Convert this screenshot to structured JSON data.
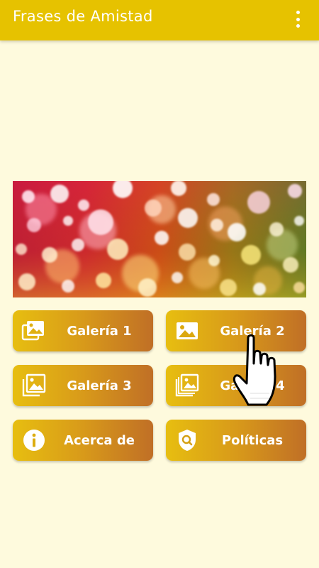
{
  "app": {
    "title": "Frases de Amistad",
    "menu_icon": "more-vert-icon"
  },
  "banner": {
    "description_icon": "bokeh-banner-image"
  },
  "buttons": [
    {
      "label": "Galería 1",
      "icon": "photo-library-icon"
    },
    {
      "label": "Galería 2",
      "icon": "image-icon"
    },
    {
      "label": "Galería 3",
      "icon": "photo-library-outline-icon"
    },
    {
      "label": "Galería 4",
      "icon": "photo-library-outline-icon"
    },
    {
      "label": "Acerca de",
      "icon": "info-icon"
    },
    {
      "label": "Políticas",
      "icon": "shield-search-icon"
    }
  ],
  "colors": {
    "appbar": "#e6c200",
    "background": "#fefadd",
    "button_start": "#e7be10",
    "button_end": "#c06f26"
  }
}
